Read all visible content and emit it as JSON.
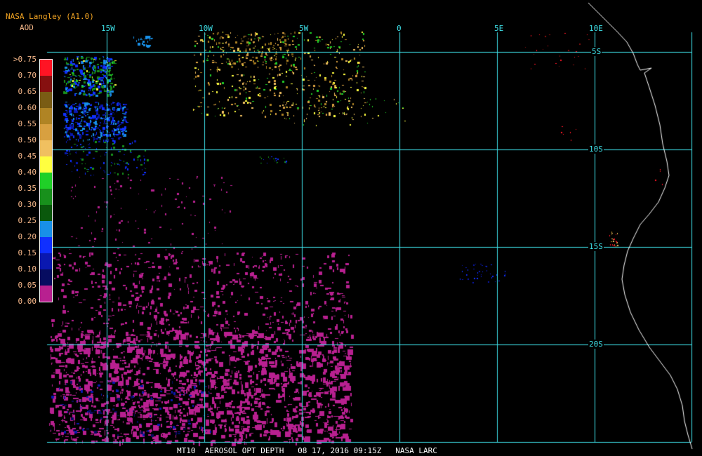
{
  "header": {
    "title": "NASA Langley (A1.0)",
    "variable": "AOD"
  },
  "legend": [
    {
      "label": ">0.75",
      "color": "#ff1424"
    },
    {
      "label": "0.70",
      "color": "#b01018"
    },
    {
      "label": "0.65",
      "color": "#861010"
    },
    {
      "label": "0.60",
      "color": "#7a5c14"
    },
    {
      "label": "0.55",
      "color": "#b08424"
    },
    {
      "label": "0.50",
      "color": "#d8a040"
    },
    {
      "label": "0.45",
      "color": "#f0c060"
    },
    {
      "label": "0.40",
      "color": "#ffff40"
    },
    {
      "label": "0.35",
      "color": "#20d028"
    },
    {
      "label": "0.30",
      "color": "#18901c"
    },
    {
      "label": "0.25",
      "color": "#0a580c"
    },
    {
      "label": "0.20",
      "color": "#1890e8"
    },
    {
      "label": "0.15",
      "color": "#1030ff"
    },
    {
      "label": "0.10",
      "color": "#0a18b0"
    },
    {
      "label": "0.05",
      "color": "#060c60"
    },
    {
      "label": "0.00",
      "color": "#b82090"
    }
  ],
  "map": {
    "longitude_labels": [
      "15W",
      "10W",
      "5W",
      "0",
      "5E",
      "10E"
    ],
    "latitude_labels": [
      "5S",
      "10S",
      "15S",
      "20S"
    ],
    "grid_color": "#3ee0e8",
    "coast_color": "#ffffff"
  },
  "footer": "MT10  AEROSOL OPT DEPTH   08 17, 2016 09:15Z   NASA LARC"
}
